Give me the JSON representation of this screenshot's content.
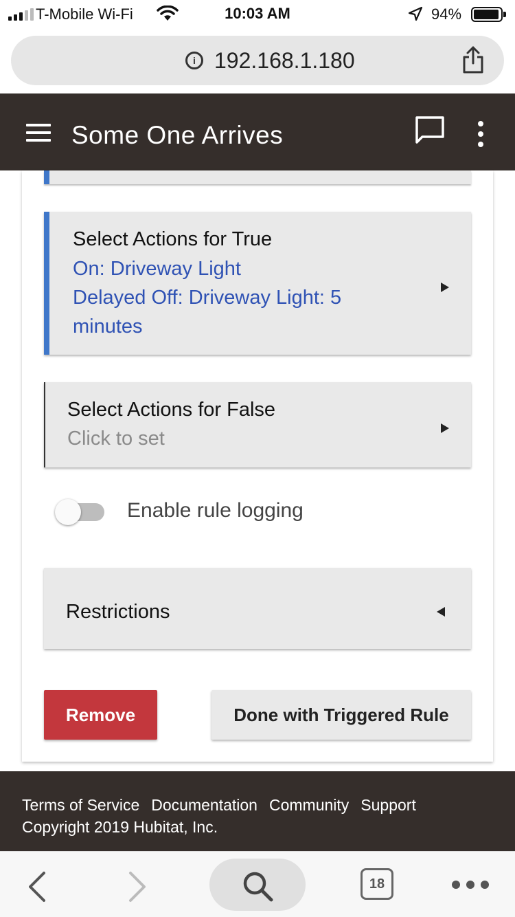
{
  "status_bar": {
    "carrier": "T-Mobile Wi-Fi",
    "time": "10:03 AM",
    "battery": "94%"
  },
  "browser": {
    "url": "192.168.1.180",
    "tab_count": "18"
  },
  "header": {
    "title": "Some One Arrives"
  },
  "sections": {
    "actions_true": {
      "title": "Select Actions for True",
      "line1": "On: Driveway Light",
      "line2": "Delayed Off: Driveway Light: 5",
      "line3": "minutes"
    },
    "actions_false": {
      "title": "Select Actions for False",
      "placeholder": "Click to set"
    },
    "logging": {
      "label": "Enable rule logging",
      "enabled": false
    },
    "restrictions": {
      "title": "Restrictions"
    }
  },
  "buttons": {
    "remove": "Remove",
    "done": "Done with Triggered Rule"
  },
  "footer": {
    "links": [
      "Terms of Service",
      "Documentation",
      "Community",
      "Support"
    ],
    "copyright": "Copyright 2019 Hubitat, Inc."
  },
  "colors": {
    "header_bg": "#352e2b",
    "accent": "#3f77c9",
    "link_text": "#2f52b4",
    "remove_bg": "#c3373d"
  }
}
